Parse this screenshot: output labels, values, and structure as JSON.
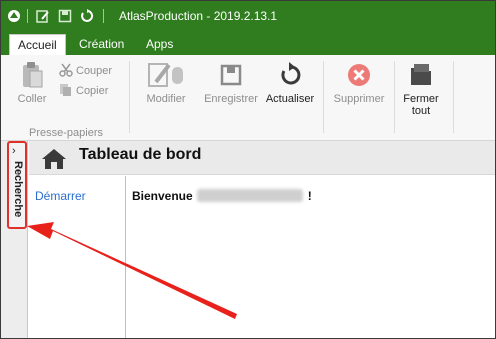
{
  "window": {
    "title": "AtlasProduction - 2019.2.13.1"
  },
  "menu": {
    "tabs": [
      {
        "label": "Accueil",
        "active": true
      },
      {
        "label": "Création",
        "active": false
      },
      {
        "label": "Apps",
        "active": false
      }
    ]
  },
  "ribbon": {
    "clipboard": {
      "paste": "Coller",
      "cut": "Couper",
      "copy": "Copier",
      "group_label": "Presse-papiers"
    },
    "buttons": {
      "edit": "Modifier",
      "save": "Enregistrer",
      "refresh": "Actualiser",
      "delete": "Supprimer",
      "close_line1": "Fermer",
      "close_line2": "tout"
    }
  },
  "side_panel": {
    "search_tab": "Recherche",
    "chevron": "›"
  },
  "page": {
    "title": "Tableau de bord",
    "nav_link": "Démarrer",
    "welcome_prefix": "Bienvenue",
    "welcome_suffix": "!"
  },
  "colors": {
    "title_bar": "#2f7d1f",
    "highlight_box": "#e0302c",
    "annotation_arrow": "#e8211b",
    "link": "#2a6fcf"
  },
  "icons": {
    "app": "app-logo-icon",
    "quick_edit": "edit-icon",
    "quick_save": "save-icon",
    "quick_refresh": "refresh-icon",
    "home": "home-icon",
    "delete": "delete-icon",
    "close_all": "folder-icon"
  }
}
